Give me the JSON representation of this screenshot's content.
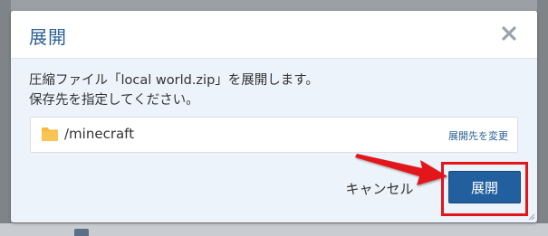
{
  "dialog": {
    "title": "展開",
    "message_line1": "圧縮ファイル「local world.zip」を展開します。",
    "message_line2": "保存先を指定してください。",
    "path": "/minecraft",
    "change_destination_label": "展開先を変更",
    "cancel_label": "キャンセル",
    "confirm_label": "展開"
  },
  "colors": {
    "accent": "#215f9e",
    "title": "#2c5f93",
    "highlight": "#e3141a",
    "folder": "#f6b93b"
  },
  "icons": {
    "close": "close-icon",
    "folder": "folder-icon",
    "arrow": "arrow-annotation",
    "resize": "resize-grip-icon"
  }
}
